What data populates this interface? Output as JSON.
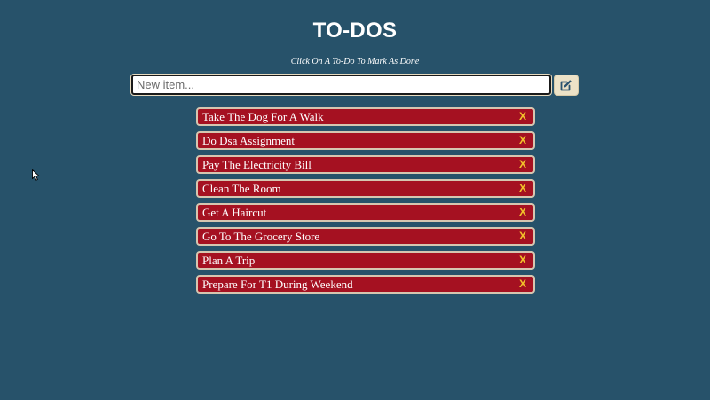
{
  "header": {
    "title": "TO-DOS",
    "subtitle": "Click On A To-Do To Mark As Done"
  },
  "new_item": {
    "placeholder": "New item...",
    "value": "",
    "button_icon": "edit-icon"
  },
  "todos": [
    {
      "text": "Take The Dog For A Walk",
      "delete_label": "X"
    },
    {
      "text": "Do Dsa Assignment",
      "delete_label": "X"
    },
    {
      "text": "Pay The Electricity Bill",
      "delete_label": "X"
    },
    {
      "text": "Clean The Room",
      "delete_label": "X"
    },
    {
      "text": "Get A Haircut",
      "delete_label": "X"
    },
    {
      "text": "Go To The Grocery Store",
      "delete_label": "X"
    },
    {
      "text": "Plan A Trip",
      "delete_label": "X"
    },
    {
      "text": "Prepare For T1 During Weekend",
      "delete_label": "X"
    }
  ],
  "colors": {
    "background": "#27526a",
    "todo_background": "#a51121",
    "todo_border": "#d6c6b0",
    "delete_color": "#f3c42a",
    "button_background": "#ece2c7",
    "button_icon": "#2b5470"
  }
}
